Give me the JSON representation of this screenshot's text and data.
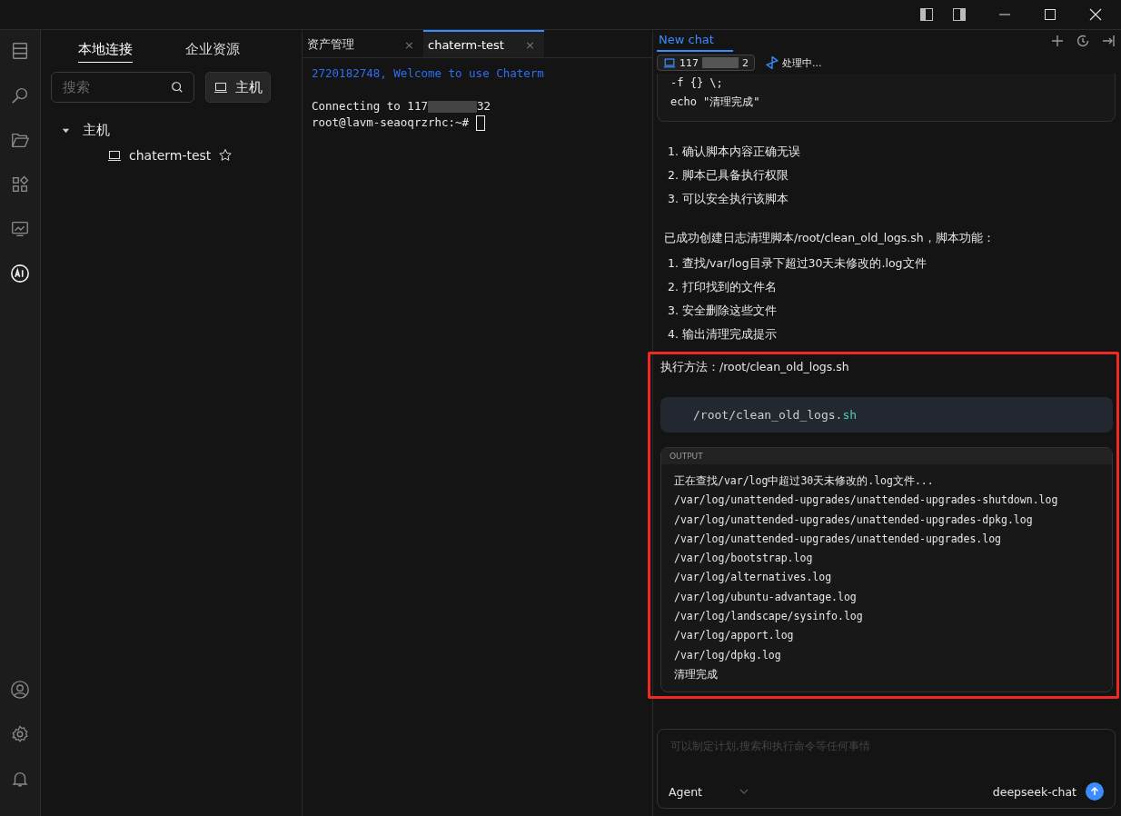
{
  "sidebar_tabs": [
    {
      "label": "本地连接",
      "selected": true
    },
    {
      "label": "企业资源",
      "selected": false
    }
  ],
  "search": {
    "placeholder": "搜索"
  },
  "host_button": "主机",
  "tree": [
    {
      "label": "主机",
      "expanded": true,
      "children": [
        {
          "label": "chaterm-test",
          "starred": false
        }
      ]
    }
  ],
  "editor_tabs": [
    {
      "label": "资产管理",
      "selected": false,
      "close": "×"
    },
    {
      "label": "chaterm-test",
      "selected": true,
      "close": "×"
    }
  ],
  "terminal": {
    "welcome": "2720182748, Welcome to use Chaterm",
    "connecting_start": "Connecting to 117",
    "connecting_end": "32",
    "prompt": "root@lavm-seaoqrzrhc:~#"
  },
  "chat": {
    "tab": "New chat",
    "host_start": "117",
    "host_end": "2",
    "status": "处理中...",
    "code_tail": [
      "-f {} \\;",
      "echo \"清理完成\""
    ],
    "list_1": [
      {
        "marker": "1.",
        "text": "确认脚本内容正确无误"
      },
      {
        "marker": "2.",
        "text": "脚本已具备执行权限"
      },
      {
        "marker": "3.",
        "text": "可以安全执行该脚本"
      }
    ],
    "summary": "已成功创建日志清理脚本/root/clean_old_logs.sh，脚本功能：",
    "list_2": [
      {
        "marker": "1.",
        "text": "查找/var/log目录下超过30天未修改的.log文件"
      },
      {
        "marker": "2.",
        "text": "打印找到的文件名"
      },
      {
        "marker": "3.",
        "text": "安全删除这些文件"
      },
      {
        "marker": "4.",
        "text": "输出清理完成提示"
      }
    ],
    "exec": "执行方法：/root/clean_old_logs.sh",
    "command": [
      {
        "text": "/root/clean_old_logs.",
        "kind": "plain"
      },
      {
        "text": "sh",
        "kind": "ext"
      }
    ],
    "output_label": "OUTPUT",
    "output": [
      "正在查找/var/log中超过30天未修改的.log文件...",
      "/var/log/unattended-upgrades/unattended-upgrades-shutdown.log",
      "/var/log/unattended-upgrades/unattended-upgrades-dpkg.log",
      "/var/log/unattended-upgrades/unattended-upgrades.log",
      "/var/log/bootstrap.log",
      "/var/log/alternatives.log",
      "/var/log/ubuntu-advantage.log",
      "/var/log/landscape/sysinfo.log",
      "/var/log/apport.log",
      "/var/log/dpkg.log",
      "清理完成"
    ],
    "input_placeholder": "可以制定计划,搜索和执行命令等任何事情",
    "mode": "Agent",
    "model": "deepseek-chat"
  }
}
